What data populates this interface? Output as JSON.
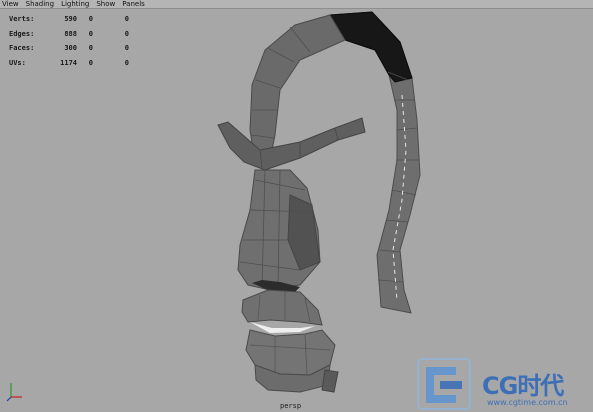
{
  "menu": [
    "View",
    "Shading",
    "Lighting",
    "Show",
    "Panels"
  ],
  "hud": [
    {
      "label": "Verts:",
      "v1": "590",
      "v2": "0",
      "v3": "0"
    },
    {
      "label": "Edges:",
      "v1": "888",
      "v2": "0",
      "v3": "0"
    },
    {
      "label": "Faces:",
      "v1": "300",
      "v2": "0",
      "v3": "0"
    },
    {
      "label": "UVs:",
      "v1": "1174",
      "v2": "0",
      "v3": "0"
    }
  ],
  "camera": "persp",
  "watermark": {
    "title": "CG时代",
    "url": "www.cgtime.com.cn"
  },
  "colors": {
    "viewport": "#a7a7a7",
    "mesh": "#6a6a6a",
    "selected": "#151515",
    "brand": "#3d6fb7"
  }
}
